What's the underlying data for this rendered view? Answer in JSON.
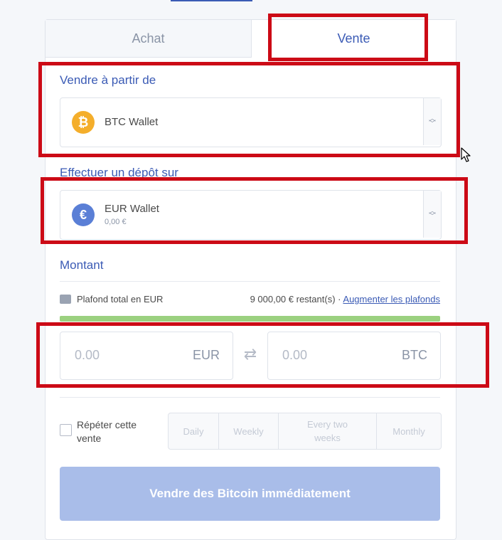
{
  "tabs": {
    "buy": "Achat",
    "sell": "Vente"
  },
  "sell_from": {
    "label": "Vendre à partir de",
    "wallet_name": "BTC Wallet",
    "coin_symbol": "₿"
  },
  "deposit_to": {
    "label": "Effectuer un dépôt sur",
    "wallet_name": "EUR Wallet",
    "balance": "0,00 €",
    "coin_symbol": "€"
  },
  "amount": {
    "label": "Montant",
    "limit_label": "Plafond total en EUR",
    "limit_remaining": "9 000,00 € restant(s)",
    "separator": "·",
    "limit_link": "Augmenter les plafonds",
    "limit_progress": 1.0,
    "fiat_value": "0.00",
    "fiat_currency": "EUR",
    "crypto_value": "0.00",
    "crypto_currency": "BTC",
    "swap_symbol": "⇄"
  },
  "repeat": {
    "label": "Répéter cette vente",
    "options": [
      "Daily",
      "Weekly",
      "Every two weeks",
      "Monthly"
    ]
  },
  "submit_label": "Vendre des Bitcoin immédiatement",
  "colors": {
    "accent": "#3b5bb5",
    "highlight": "#cc0a16",
    "btc": "#f4ae2b",
    "eur": "#5a7fd6",
    "submit_disabled": "#a9bde9"
  }
}
